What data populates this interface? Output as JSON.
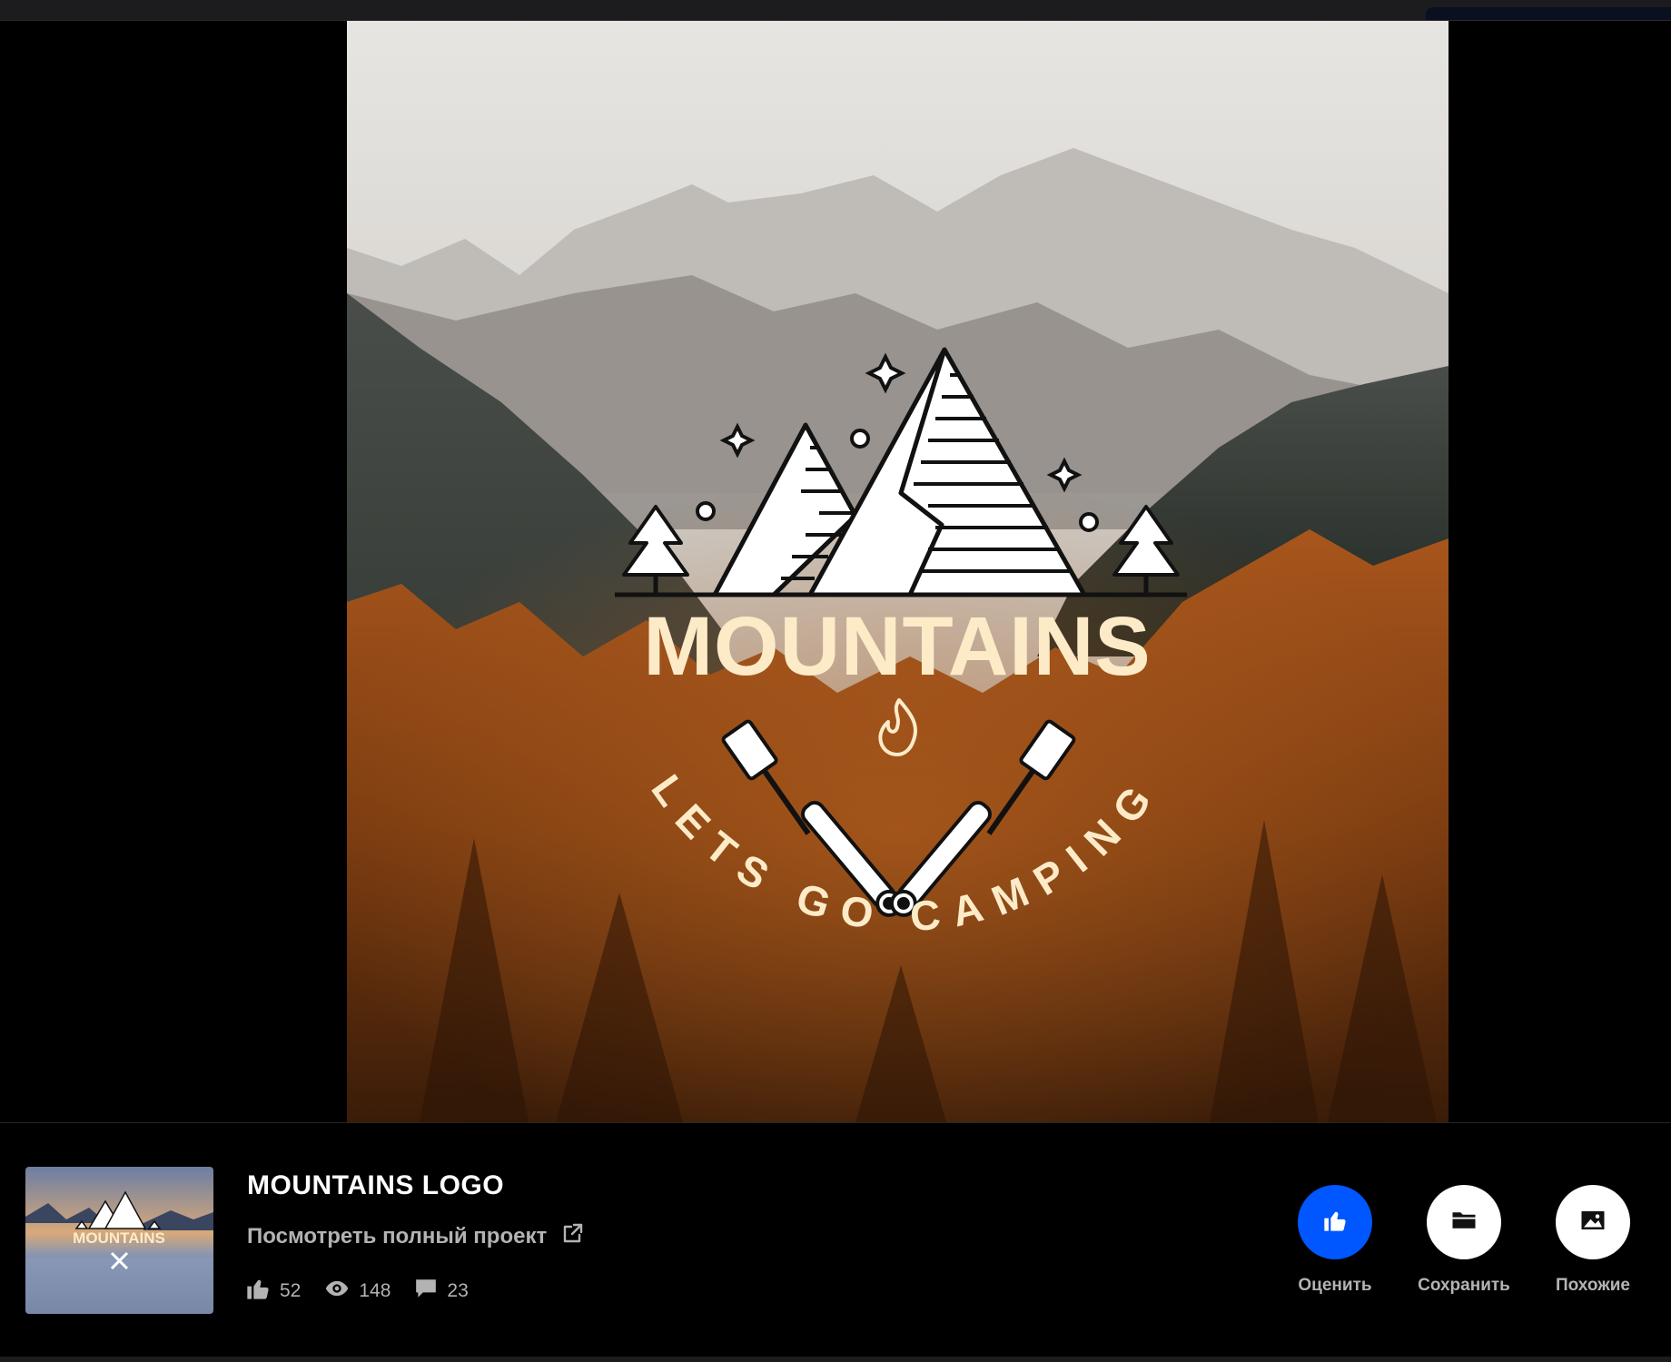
{
  "artwork": {
    "logo_title": "MOUNTAINS",
    "logo_tagline": "LETS GO CAMPING"
  },
  "project": {
    "title": "MOUNTAINS LOGO",
    "view_full_link": "Посмотреть полный проект",
    "thumbnail_alt": "MOUNTAINS"
  },
  "stats": {
    "likes": "52",
    "views": "148",
    "comments": "23"
  },
  "actions": {
    "appreciate_label": "Оценить",
    "save_label": "Сохранить",
    "similar_label": "Похожие"
  },
  "colors": {
    "accent": "#0057ff",
    "logo_title": "#fdebc8",
    "logo_white": "#ffffff"
  },
  "icons": {
    "like": "thumbs-up-icon",
    "views": "eye-icon",
    "comments": "comment-icon",
    "external": "external-link-icon",
    "save": "folder-icon",
    "similar": "image-icon"
  }
}
